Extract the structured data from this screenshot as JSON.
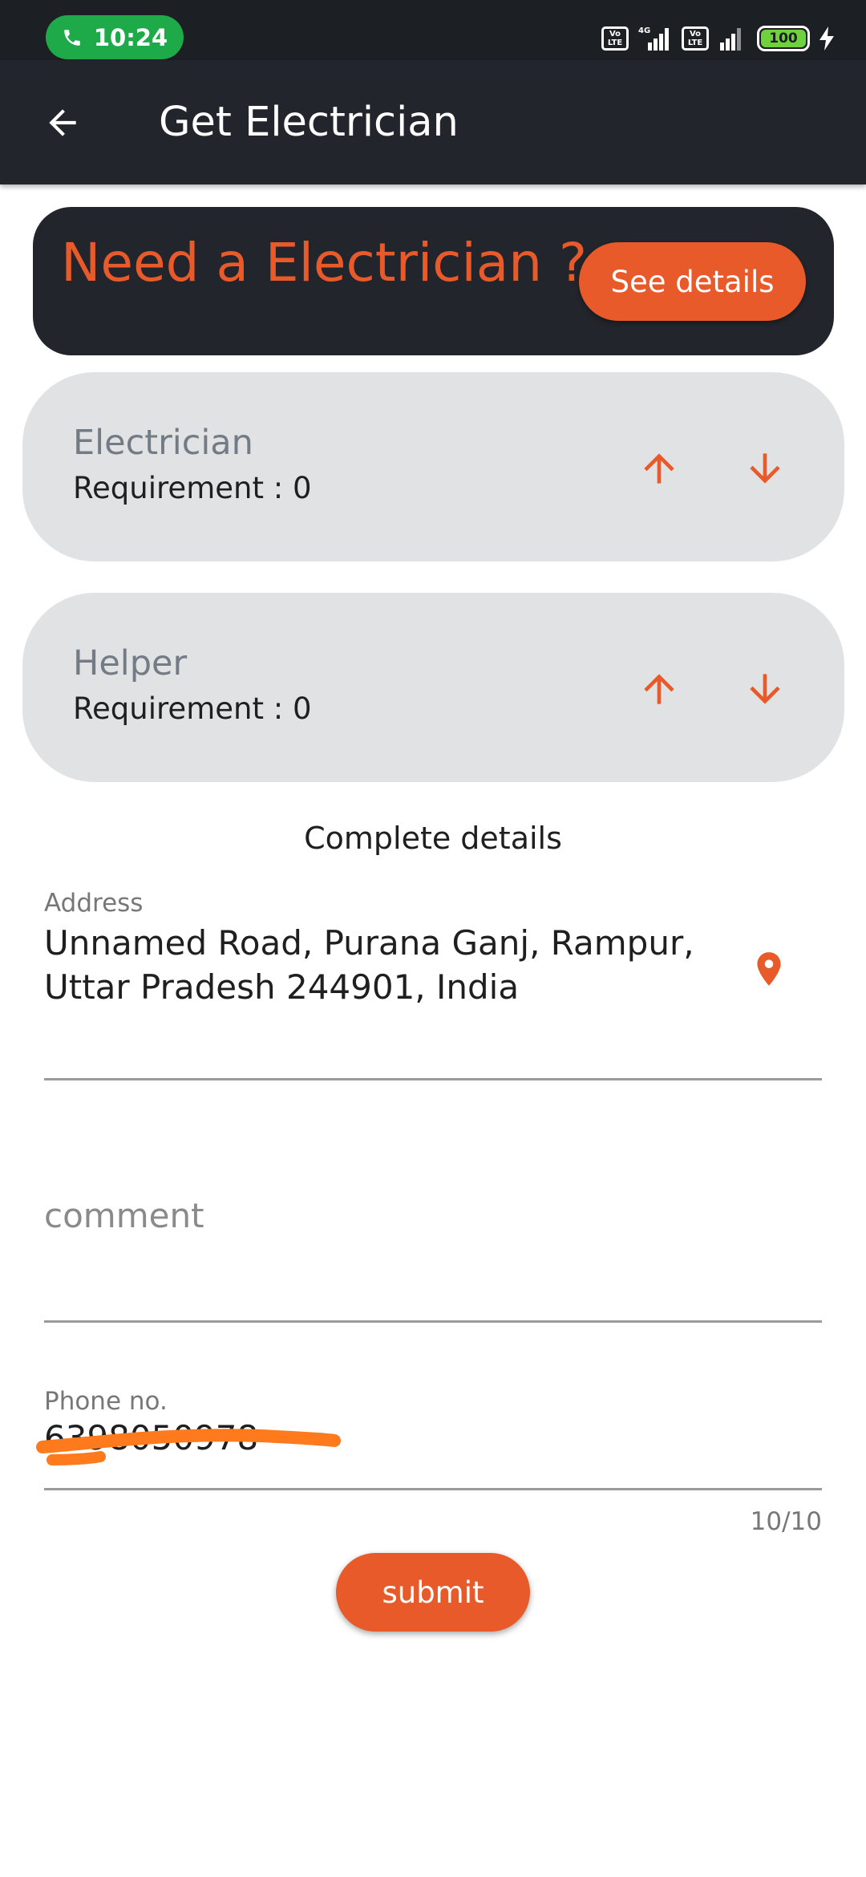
{
  "status_bar": {
    "time": "10:24",
    "network_label": "4G",
    "volte_label_top": "Vo",
    "volte_label_bottom": "LTE",
    "battery_level": "100",
    "icons": [
      "phone-call-icon",
      "volte-icon",
      "signal-icon",
      "battery-icon",
      "charging-icon"
    ]
  },
  "app_bar": {
    "title": "Get Electrician",
    "back_icon": "back-arrow-icon"
  },
  "banner": {
    "text": "Need a Electrician ?",
    "button_label": "See details"
  },
  "requirements": [
    {
      "title": "Electrician",
      "count_label": "Requirement : 0"
    },
    {
      "title": "Helper",
      "count_label": "Requirement : 0"
    }
  ],
  "details": {
    "heading": "Complete details",
    "address_label": "Address",
    "address_value": "Unnamed Road, Purana Ganj, Rampur, Uttar Pradesh 244901, India",
    "comment_placeholder": "comment",
    "phone_label": "Phone no.",
    "phone_value": "6398050978",
    "phone_counter": "10/10"
  },
  "submit_label": "submit",
  "colors": {
    "accent": "#e95a2b",
    "dark": "#22262c",
    "card": "#e1e2e4",
    "status_green": "#1faa4a"
  }
}
